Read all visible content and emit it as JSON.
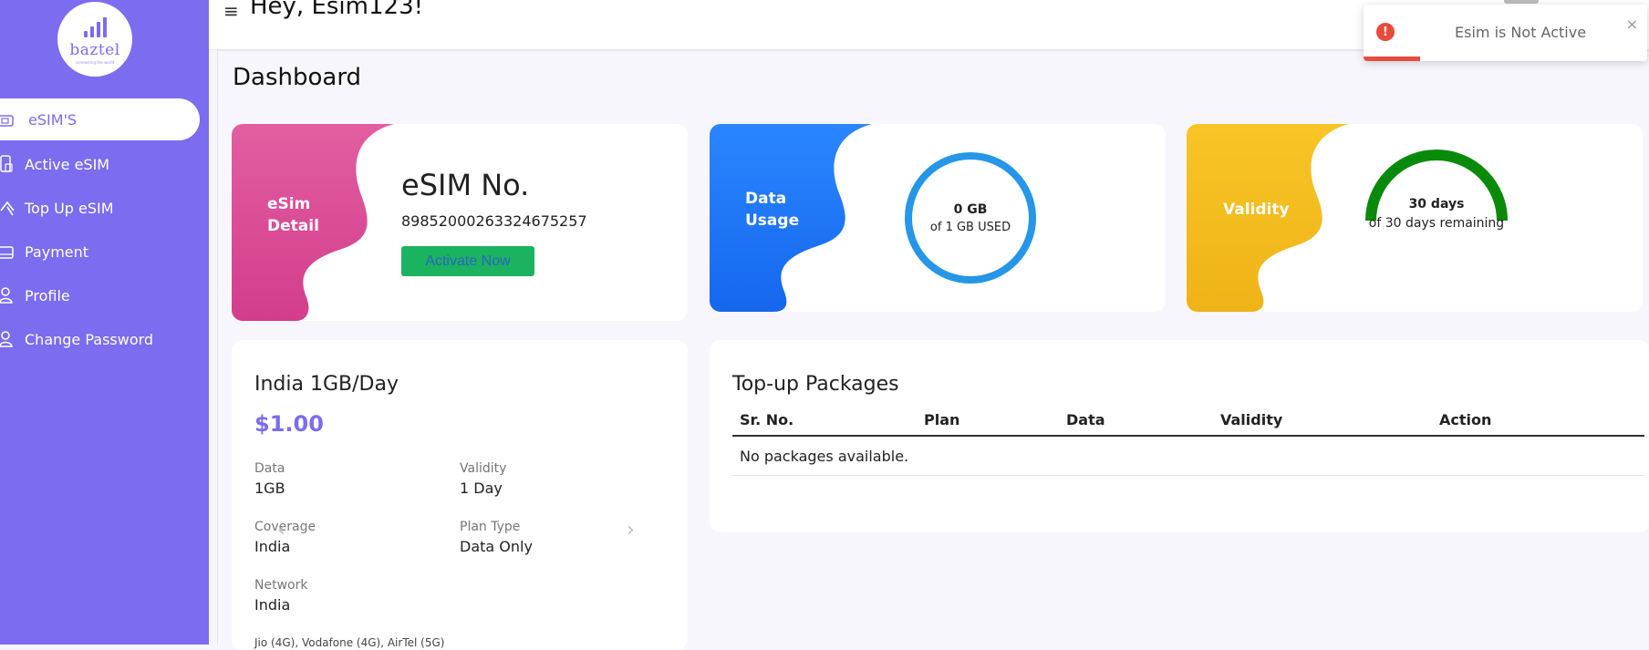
{
  "app": {
    "logo_text": "baztel",
    "logo_tagline": "connecting the world"
  },
  "sidebar": {
    "items": [
      {
        "label": "eSIM'S",
        "icon": "sim-card-icon",
        "active": true
      },
      {
        "label": "Active eSIM",
        "icon": "mobile-icon"
      },
      {
        "label": "Top Up eSIM",
        "icon": "arrow-up-icon"
      },
      {
        "label": "Payment",
        "icon": "credit-card-icon"
      },
      {
        "label": "Profile",
        "icon": "user-icon"
      },
      {
        "label": "Change Password",
        "icon": "lock-user-icon"
      }
    ]
  },
  "header": {
    "menu_icon": "≡",
    "greeting": "Hey, Esim123!"
  },
  "toast": {
    "icon": "!",
    "message": "Esim is Not Active",
    "close": "×",
    "color": "#e74c3c"
  },
  "page": {
    "title": "Dashboard"
  },
  "esim_card": {
    "label_line1": "eSim",
    "label_line2": "Detail",
    "title": "eSIM No.",
    "number": "89852000263324675257",
    "activate_label": "Activate Now",
    "color": "#e0519a"
  },
  "data_card": {
    "label_line1": "Data",
    "label_line2": "Usage",
    "used": "0 GB",
    "of_text": "of 1 GB USED",
    "used_fraction": 0,
    "color": "#1e7bff"
  },
  "validity_card": {
    "label": "Validity",
    "days": "30 days",
    "remaining_text": "of 30 days remaining",
    "remaining_fraction": 1,
    "color": "#f6bd1e",
    "gauge_color": "#0a8a0a"
  },
  "plan": {
    "name": "India 1GB/Day",
    "price": "$1.00",
    "data_label": "Data",
    "data_value": "1GB",
    "validity_label": "Validity",
    "validity_value": "1 Day",
    "coverage_label": "Coverage",
    "coverage_value": "India",
    "plan_type_label": "Plan Type",
    "plan_type_value": "Data Only",
    "network_label": "Network",
    "network_value": "India",
    "network_list": "Jio (4G), Vodafone (4G), AirTel (5G)",
    "prev_arrow": "‹",
    "next_arrow": "›"
  },
  "topup": {
    "title": "Top-up Packages",
    "columns": [
      "Sr. No.",
      "Plan",
      "Data",
      "Validity",
      "Action"
    ],
    "empty_text": "No packages available."
  }
}
